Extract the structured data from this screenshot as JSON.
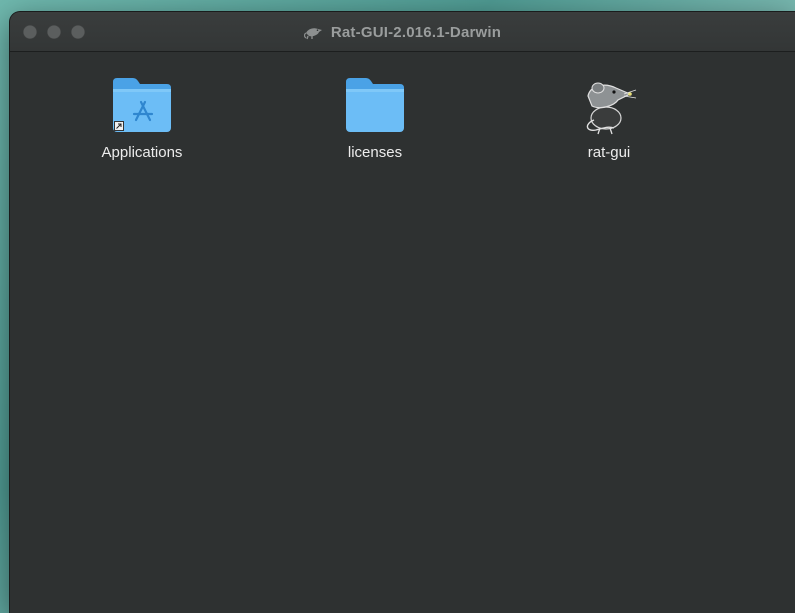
{
  "window": {
    "title": "Rat-GUI-2.016.1-Darwin",
    "title_icon": "rat-icon",
    "traffic_lights": [
      "close-button",
      "minimize-button",
      "zoom-button"
    ]
  },
  "items": [
    {
      "label": "Applications",
      "icon": "applications-folder-alias-icon"
    },
    {
      "label": "licenses",
      "icon": "folder-icon"
    },
    {
      "label": "rat-gui",
      "icon": "rat-app-icon"
    }
  ],
  "colors": {
    "window_background": "#2e3131",
    "folder_blue": "#5fb3f2",
    "folder_tab": "#4aa2e6",
    "label_text": "#ececec",
    "title_text": "#9a9d9d"
  }
}
